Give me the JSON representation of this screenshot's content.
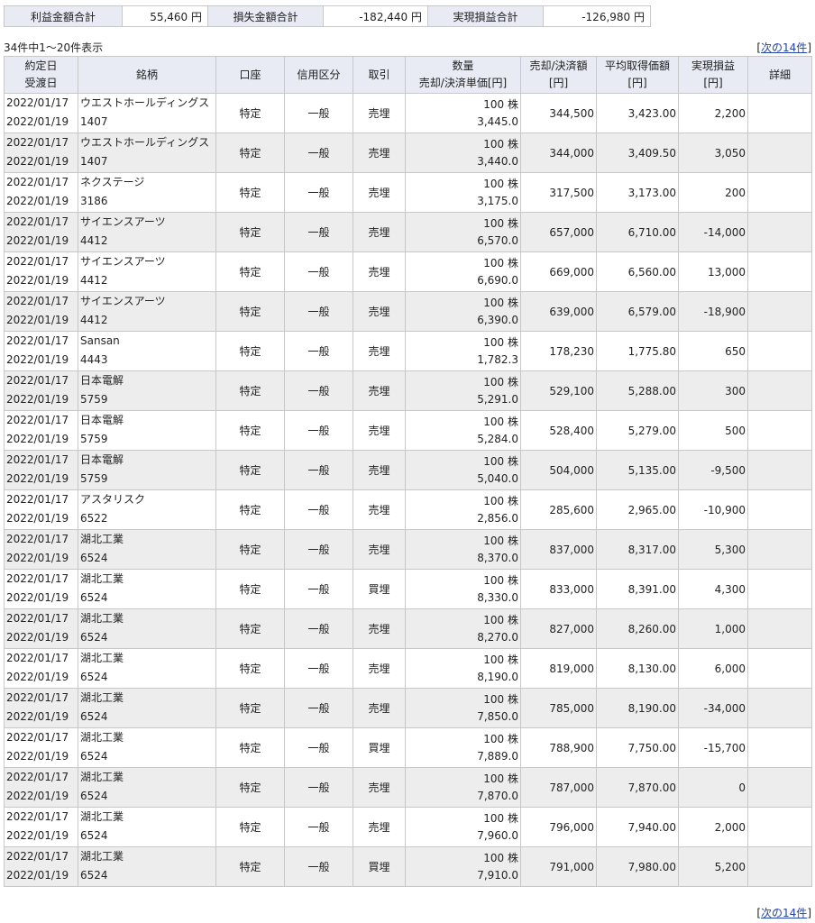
{
  "summary": {
    "profit_label": "利益金額合計",
    "profit_value": "55,460 円",
    "loss_label": "損失金額合計",
    "loss_value": "-182,440 円",
    "realized_label": "実現損益合計",
    "realized_value": "-126,980 円"
  },
  "pager": {
    "count_text": "34件中1～20件表示",
    "next_prefix": "[",
    "next_label": "次の14件",
    "next_suffix": "]"
  },
  "headers": {
    "date_line1": "約定日",
    "date_line2": "受渡日",
    "stock": "銘柄",
    "account": "口座",
    "credit": "信用区分",
    "trade": "取引",
    "qty_line1": "数量",
    "qty_line2": "売却/決済単価[円]",
    "sale_line1": "売却/決済額",
    "sale_line2": "[円]",
    "avg_line1": "平均取得価額",
    "avg_line2": "[円]",
    "realized_line1": "実現損益",
    "realized_line2": "[円]",
    "detail": "詳細"
  },
  "rows": [
    {
      "trade_date": "2022/01/17",
      "settle_date": "2022/01/19",
      "name": "ウエストホールディングス",
      "code": "1407",
      "account": "特定",
      "credit": "一般",
      "trade": "売埋",
      "qty": "100 株",
      "unit_price": "3,445.0",
      "sale_amount": "344,500",
      "avg_cost": "3,423.00",
      "realized": "2,200"
    },
    {
      "trade_date": "2022/01/17",
      "settle_date": "2022/01/19",
      "name": "ウエストホールディングス",
      "code": "1407",
      "account": "特定",
      "credit": "一般",
      "trade": "売埋",
      "qty": "100 株",
      "unit_price": "3,440.0",
      "sale_amount": "344,000",
      "avg_cost": "3,409.50",
      "realized": "3,050"
    },
    {
      "trade_date": "2022/01/17",
      "settle_date": "2022/01/19",
      "name": "ネクステージ",
      "code": "3186",
      "account": "特定",
      "credit": "一般",
      "trade": "売埋",
      "qty": "100 株",
      "unit_price": "3,175.0",
      "sale_amount": "317,500",
      "avg_cost": "3,173.00",
      "realized": "200"
    },
    {
      "trade_date": "2022/01/17",
      "settle_date": "2022/01/19",
      "name": "サイエンスアーツ",
      "code": "4412",
      "account": "特定",
      "credit": "一般",
      "trade": "売埋",
      "qty": "100 株",
      "unit_price": "6,570.0",
      "sale_amount": "657,000",
      "avg_cost": "6,710.00",
      "realized": "-14,000"
    },
    {
      "trade_date": "2022/01/17",
      "settle_date": "2022/01/19",
      "name": "サイエンスアーツ",
      "code": "4412",
      "account": "特定",
      "credit": "一般",
      "trade": "売埋",
      "qty": "100 株",
      "unit_price": "6,690.0",
      "sale_amount": "669,000",
      "avg_cost": "6,560.00",
      "realized": "13,000"
    },
    {
      "trade_date": "2022/01/17",
      "settle_date": "2022/01/19",
      "name": "サイエンスアーツ",
      "code": "4412",
      "account": "特定",
      "credit": "一般",
      "trade": "売埋",
      "qty": "100 株",
      "unit_price": "6,390.0",
      "sale_amount": "639,000",
      "avg_cost": "6,579.00",
      "realized": "-18,900"
    },
    {
      "trade_date": "2022/01/17",
      "settle_date": "2022/01/19",
      "name": "Sansan",
      "code": "4443",
      "account": "特定",
      "credit": "一般",
      "trade": "売埋",
      "qty": "100 株",
      "unit_price": "1,782.3",
      "sale_amount": "178,230",
      "avg_cost": "1,775.80",
      "realized": "650"
    },
    {
      "trade_date": "2022/01/17",
      "settle_date": "2022/01/19",
      "name": "日本電解",
      "code": "5759",
      "account": "特定",
      "credit": "一般",
      "trade": "売埋",
      "qty": "100 株",
      "unit_price": "5,291.0",
      "sale_amount": "529,100",
      "avg_cost": "5,288.00",
      "realized": "300"
    },
    {
      "trade_date": "2022/01/17",
      "settle_date": "2022/01/19",
      "name": "日本電解",
      "code": "5759",
      "account": "特定",
      "credit": "一般",
      "trade": "売埋",
      "qty": "100 株",
      "unit_price": "5,284.0",
      "sale_amount": "528,400",
      "avg_cost": "5,279.00",
      "realized": "500"
    },
    {
      "trade_date": "2022/01/17",
      "settle_date": "2022/01/19",
      "name": "日本電解",
      "code": "5759",
      "account": "特定",
      "credit": "一般",
      "trade": "売埋",
      "qty": "100 株",
      "unit_price": "5,040.0",
      "sale_amount": "504,000",
      "avg_cost": "5,135.00",
      "realized": "-9,500"
    },
    {
      "trade_date": "2022/01/17",
      "settle_date": "2022/01/19",
      "name": "アスタリスク",
      "code": "6522",
      "account": "特定",
      "credit": "一般",
      "trade": "売埋",
      "qty": "100 株",
      "unit_price": "2,856.0",
      "sale_amount": "285,600",
      "avg_cost": "2,965.00",
      "realized": "-10,900"
    },
    {
      "trade_date": "2022/01/17",
      "settle_date": "2022/01/19",
      "name": "湖北工業",
      "code": "6524",
      "account": "特定",
      "credit": "一般",
      "trade": "売埋",
      "qty": "100 株",
      "unit_price": "8,370.0",
      "sale_amount": "837,000",
      "avg_cost": "8,317.00",
      "realized": "5,300"
    },
    {
      "trade_date": "2022/01/17",
      "settle_date": "2022/01/19",
      "name": "湖北工業",
      "code": "6524",
      "account": "特定",
      "credit": "一般",
      "trade": "買埋",
      "qty": "100 株",
      "unit_price": "8,330.0",
      "sale_amount": "833,000",
      "avg_cost": "8,391.00",
      "realized": "4,300"
    },
    {
      "trade_date": "2022/01/17",
      "settle_date": "2022/01/19",
      "name": "湖北工業",
      "code": "6524",
      "account": "特定",
      "credit": "一般",
      "trade": "売埋",
      "qty": "100 株",
      "unit_price": "8,270.0",
      "sale_amount": "827,000",
      "avg_cost": "8,260.00",
      "realized": "1,000"
    },
    {
      "trade_date": "2022/01/17",
      "settle_date": "2022/01/19",
      "name": "湖北工業",
      "code": "6524",
      "account": "特定",
      "credit": "一般",
      "trade": "売埋",
      "qty": "100 株",
      "unit_price": "8,190.0",
      "sale_amount": "819,000",
      "avg_cost": "8,130.00",
      "realized": "6,000"
    },
    {
      "trade_date": "2022/01/17",
      "settle_date": "2022/01/19",
      "name": "湖北工業",
      "code": "6524",
      "account": "特定",
      "credit": "一般",
      "trade": "売埋",
      "qty": "100 株",
      "unit_price": "7,850.0",
      "sale_amount": "785,000",
      "avg_cost": "8,190.00",
      "realized": "-34,000"
    },
    {
      "trade_date": "2022/01/17",
      "settle_date": "2022/01/19",
      "name": "湖北工業",
      "code": "6524",
      "account": "特定",
      "credit": "一般",
      "trade": "買埋",
      "qty": "100 株",
      "unit_price": "7,889.0",
      "sale_amount": "788,900",
      "avg_cost": "7,750.00",
      "realized": "-15,700"
    },
    {
      "trade_date": "2022/01/17",
      "settle_date": "2022/01/19",
      "name": "湖北工業",
      "code": "6524",
      "account": "特定",
      "credit": "一般",
      "trade": "売埋",
      "qty": "100 株",
      "unit_price": "7,870.0",
      "sale_amount": "787,000",
      "avg_cost": "7,870.00",
      "realized": "0"
    },
    {
      "trade_date": "2022/01/17",
      "settle_date": "2022/01/19",
      "name": "湖北工業",
      "code": "6524",
      "account": "特定",
      "credit": "一般",
      "trade": "売埋",
      "qty": "100 株",
      "unit_price": "7,960.0",
      "sale_amount": "796,000",
      "avg_cost": "7,940.00",
      "realized": "2,000"
    },
    {
      "trade_date": "2022/01/17",
      "settle_date": "2022/01/19",
      "name": "湖北工業",
      "code": "6524",
      "account": "特定",
      "credit": "一般",
      "trade": "買埋",
      "qty": "100 株",
      "unit_price": "7,910.0",
      "sale_amount": "791,000",
      "avg_cost": "7,980.00",
      "realized": "5,200"
    }
  ]
}
